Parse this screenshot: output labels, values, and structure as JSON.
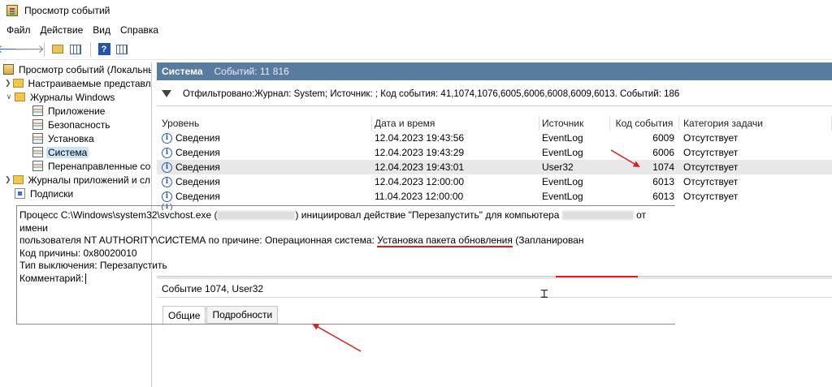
{
  "window": {
    "title": "Просмотр событий"
  },
  "menu": [
    "Файл",
    "Действие",
    "Вид",
    "Справка"
  ],
  "toolbar": {
    "back": "Назад",
    "forward": "Вперед",
    "help": "?"
  },
  "tree": {
    "root": "Просмотр событий (Локальны",
    "custom_views": "Настраиваемые представле",
    "windows_logs": "Журналы Windows",
    "application": "Приложение",
    "security": "Безопасность",
    "setup": "Установка",
    "system": "Система",
    "forwarded": "Перенаправленные соб",
    "app_services_logs": "Журналы приложений и сл",
    "subscriptions": "Подписки"
  },
  "header": {
    "name": "Система",
    "count": "Событий: 11 816"
  },
  "filter": {
    "text": "Отфильтровано:Журнал: System; Источник: ; Код события: 41,1074,1076,6005,6006,6008,6009,6013. Событий: 186"
  },
  "columns": {
    "level": "Уровень",
    "date": "Дата и время",
    "source": "Источник",
    "code": "Код события",
    "category": "Категория задачи"
  },
  "events": [
    {
      "level": "Сведения",
      "date": "12.04.2023 19:43:56",
      "source": "EventLog",
      "code": "6009",
      "category": "Отсутствует"
    },
    {
      "level": "Сведения",
      "date": "12.04.2023 19:43:29",
      "source": "EventLog",
      "code": "6006",
      "category": "Отсутствует"
    },
    {
      "level": "Сведения",
      "date": "12.04.2023 19:43:01",
      "source": "User32",
      "code": "1074",
      "category": "Отсутствует"
    },
    {
      "level": "Сведения",
      "date": "12.04.2023 12:00:00",
      "source": "EventLog",
      "code": "6013",
      "category": "Отсутствует"
    },
    {
      "level": "Сведения",
      "date": "11.04.2023 12:00:00",
      "source": "EventLog",
      "code": "6013",
      "category": "Отсутствует"
    }
  ],
  "details": {
    "header": "Событие 1074, User32",
    "tab_general": "Общие",
    "tab_details": "Подробности",
    "line1_a": "Процесс C:\\Windows\\system32\\svchost.exe (",
    "line1_b": ") инициировал действие \"Перезапустить\" для компьютера ",
    "line1_c": " от имени",
    "line2_a": "пользователя NT AUTHORITY\\СИСТЕМА по причине: Операционная система: ",
    "line2_b": "Установка пакета обновления",
    "line2_c": " (Запланирован",
    "line3": "Код причины: 0x80020010",
    "line4": "Тип выключения: Перезапустить",
    "line5": "Комментарий:"
  },
  "colors": {
    "header_bg": "#5a7ba0",
    "selection": "#cce4f7",
    "annotation": "#d81e1e",
    "info": "#2d5fa8"
  }
}
